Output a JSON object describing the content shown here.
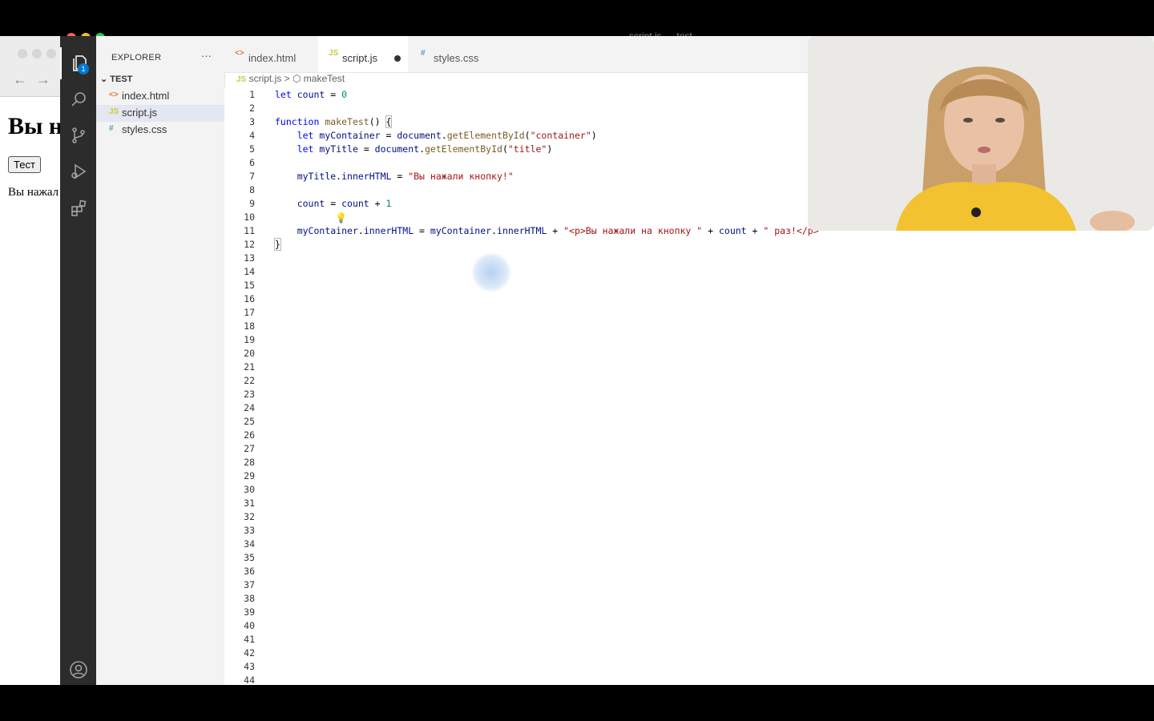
{
  "browser": {
    "heading": "Вы н",
    "button": "Тест",
    "paragraph": "Вы нажал"
  },
  "window": {
    "title": "script.js — test"
  },
  "activity": {
    "explorer_badge": "1"
  },
  "explorer": {
    "title": "EXPLORER",
    "more": "···",
    "folder": "TEST",
    "files": [
      {
        "icon": "<>",
        "name": "index.html"
      },
      {
        "icon": "JS",
        "name": "script.js"
      },
      {
        "icon": "#",
        "name": "styles.css"
      }
    ]
  },
  "tabs": [
    {
      "icon": "<>",
      "name": "index.html"
    },
    {
      "icon": "JS",
      "name": "script.js"
    },
    {
      "icon": "#",
      "name": "styles.css"
    }
  ],
  "breadcrumb": {
    "file_icon": "JS",
    "file": "script.js",
    "sep": ">",
    "symbol": "makeTest"
  },
  "editor": {
    "line_count": 44,
    "lines": [
      "let count = 0",
      "",
      "function makeTest() {",
      "    let myContainer = document.getElementById(\"container\")",
      "    let myTitle = document.getElementById(\"title\")",
      "",
      "    myTitle.innerHTML = \"Вы нажали кнопку!\"",
      "",
      "    count = count + 1",
      "",
      "    myContainer.innerHTML = myContainer.innerHTML + \"<p>Вы нажали на кнопку \" + count + \" раз!</p>\"",
      "}"
    ]
  },
  "colors": {
    "keyword": "#0000ff",
    "function": "#795e26",
    "string": "#a31515",
    "variable": "#001080",
    "number": "#098658",
    "activity_bar": "#2c2c2c",
    "sidebar": "#f3f3f3",
    "badge": "#0078d4"
  }
}
